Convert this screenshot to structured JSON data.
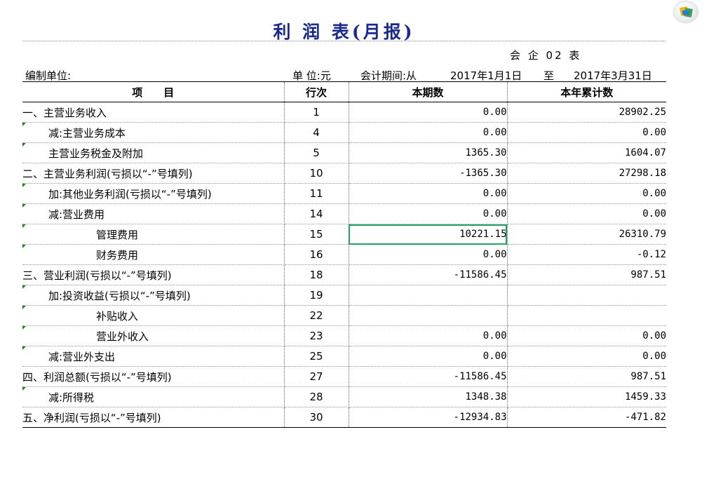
{
  "report": {
    "title": "利 润 表(月报)",
    "code": "会 企 02 表",
    "unit_label": "编制单位:",
    "currency_label": "单 位:元",
    "period_label": "会计期间:从",
    "start_date": "2017年1月1日",
    "to_label": "至",
    "end_date": "2017年3月31日"
  },
  "table": {
    "headers": [
      "项　　目",
      "行次",
      "本期数",
      "本年累计数"
    ],
    "rows": [
      {
        "item": "一、主营业务收入",
        "line": "1",
        "current": "0.00",
        "ytd": "28902.25"
      },
      {
        "item": "减:主营业务成本",
        "line": "4",
        "current": "0.00",
        "ytd": "0.00"
      },
      {
        "item": "主营业务税金及附加",
        "line": "5",
        "current": "1365.30",
        "ytd": "1604.07"
      },
      {
        "item": "二、主营业务利润(亏损以“-”号填列)",
        "line": "10",
        "current": "-1365.30",
        "ytd": "27298.18"
      },
      {
        "item": "加:其他业务利润(亏损以“-”号填列)",
        "line": "11",
        "current": "0.00",
        "ytd": "0.00"
      },
      {
        "item": "减:营业费用",
        "line": "14",
        "current": "0.00",
        "ytd": "0.00"
      },
      {
        "item": "管理费用",
        "line": "15",
        "current": "10221.15",
        "ytd": "26310.79"
      },
      {
        "item": "财务费用",
        "line": "16",
        "current": "0.00",
        "ytd": "-0.12"
      },
      {
        "item": "三、营业利润(亏损以“-”号填列)",
        "line": "18",
        "current": "-11586.45",
        "ytd": "987.51"
      },
      {
        "item": "加:投资收益(亏损以“-”号填列)",
        "line": "19",
        "current": "",
        "ytd": ""
      },
      {
        "item": "补贴收入",
        "line": "22",
        "current": "",
        "ytd": ""
      },
      {
        "item": "营业外收入",
        "line": "23",
        "current": "0.00",
        "ytd": "0.00"
      },
      {
        "item": "减:营业外支出",
        "line": "25",
        "current": "0.00",
        "ytd": "0.00"
      },
      {
        "item": "四、利润总额(亏损以“-”号填列)",
        "line": "27",
        "current": "-11586.45",
        "ytd": "987.51"
      },
      {
        "item": "减:所得税",
        "line": "28",
        "current": "1348.38",
        "ytd": "1459.33"
      },
      {
        "item": "五、净利润(亏损以“-”号填列)",
        "line": "30",
        "current": "-12934.83",
        "ytd": "-471.82"
      }
    ]
  },
  "icons": {
    "corner": "office-app-icon"
  },
  "colors": {
    "title": "#1a2a8c",
    "selection": "#21a366",
    "comment_marker": "#2a7a2a"
  }
}
